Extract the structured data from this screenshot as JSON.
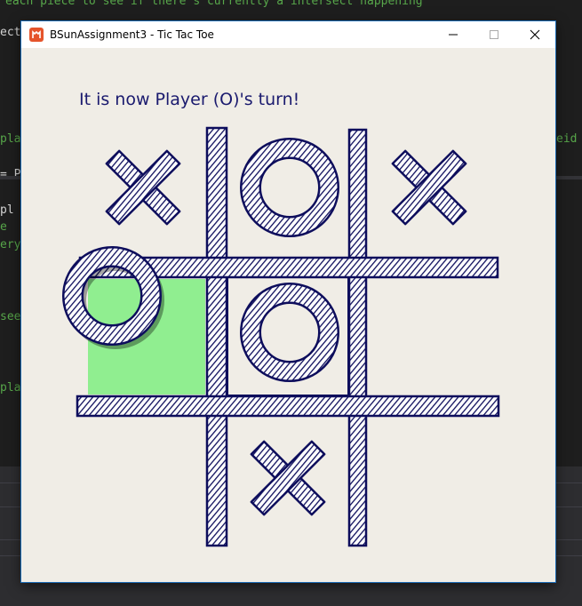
{
  "background": {
    "code_lines": [
      {
        "text": "each piece to see if there's currently a intersect happening",
        "green": true
      },
      {
        "text": "ect",
        "green": false
      },
      {
        "text": "pla",
        "green": true
      },
      {
        "text": "eid",
        "green": true
      },
      {
        "text": "= P",
        "green": false
      },
      {
        "text": " pl",
        "green": false
      },
      {
        "text": "e",
        "green": true
      },
      {
        "text": "ery",
        "green": true
      },
      {
        "text": "see",
        "green": true
      },
      {
        "text": "pla",
        "green": true
      }
    ]
  },
  "window": {
    "title": "BSunAssignment3 - Tic Tac Toe",
    "app_icon": "monogame-icon",
    "controls": [
      "minimize-icon",
      "maximize-icon",
      "close-icon"
    ]
  },
  "game": {
    "status": "It is now Player (O)'s turn!",
    "grid_color": "#0d0d5c",
    "highlight_color": "#90ee90",
    "hovered_cell": 3,
    "cursor_piece": "O",
    "board": [
      "X",
      "O",
      "X",
      "",
      "O",
      "",
      "",
      "X",
      ""
    ]
  }
}
